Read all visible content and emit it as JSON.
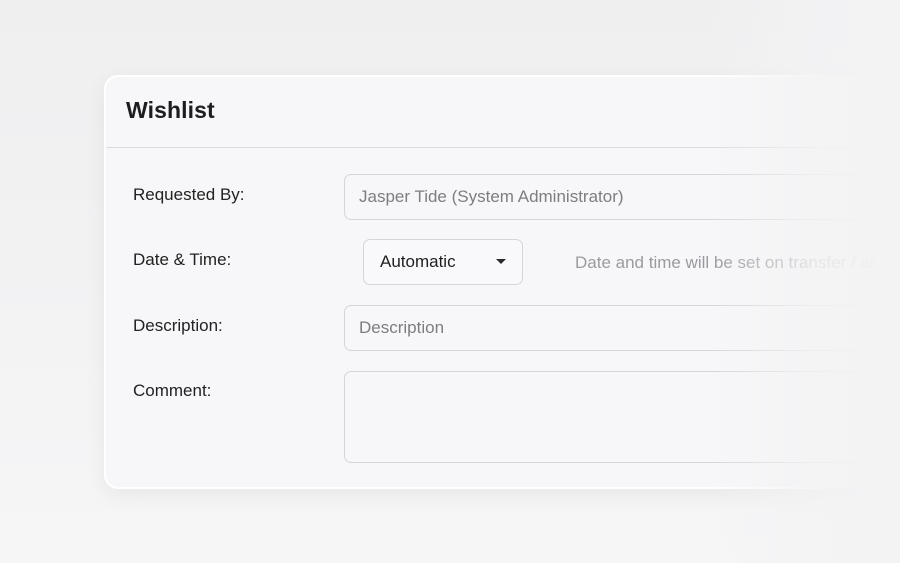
{
  "panel": {
    "title": "Wishlist"
  },
  "form": {
    "requested_by": {
      "label": "Requested By:",
      "value": "Jasper Tide (System Administrator)"
    },
    "date_time": {
      "label": "Date & Time:",
      "selected": "Automatic",
      "hint": "Date and time will be set on transfer / ar"
    },
    "description": {
      "label": "Description:",
      "placeholder": "Description"
    },
    "comment": {
      "label": "Comment:",
      "value": ""
    }
  }
}
